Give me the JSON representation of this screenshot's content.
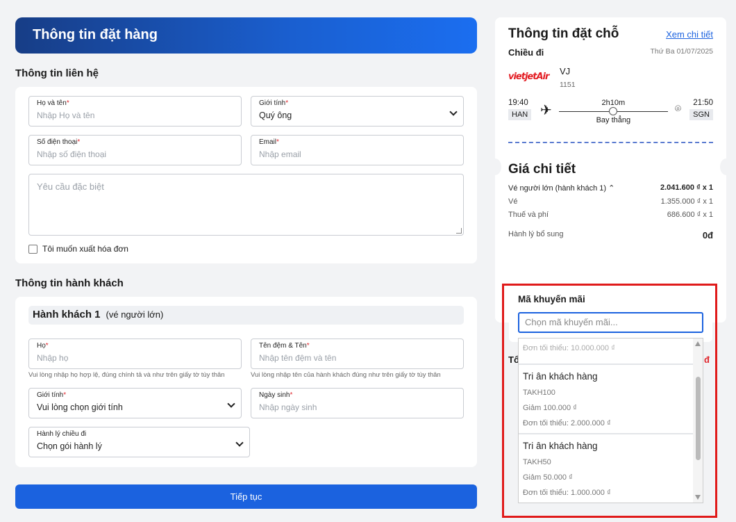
{
  "order": {
    "hero_title": "Thông tin đặt hàng",
    "contact_title": "Thông tin liên hệ",
    "fullname_label": "Họ và tên",
    "fullname_placeholder": "Nhập Họ và tên",
    "gender_label": "Giới tính",
    "gender_value": "Quý ông",
    "phone_label": "Số điện thoại",
    "phone_placeholder": "Nhập số điện thoại",
    "email_label": "Email",
    "email_placeholder": "Nhập email",
    "special_placeholder": "Yêu cầu đặc biệt",
    "invoice_label": "Tôi muốn xuất hóa đơn",
    "passenger_title": "Thông tin hành khách",
    "pax_heading": "Hành khách 1",
    "pax_type": "(vé người lớn)",
    "last_label": "Họ",
    "last_placeholder": "Nhập họ",
    "last_hint": "Vui lòng nhập họ hợp lệ, đúng chính tả và như trên giấy tờ tùy thân",
    "given_label": "Tên đệm & Tên",
    "given_placeholder": "Nhập tên đệm và tên",
    "given_hint": "Vui lòng nhập tên của hành khách đúng như trên giấy tờ tùy thân",
    "pax_gender_label": "Giới tính",
    "pax_gender_value": "Vui lòng chọn giới tính",
    "dob_label": "Ngày sinh",
    "dob_placeholder": "Nhập ngày sinh",
    "luggage_label": "Hành lý chiều đi",
    "luggage_value": "Chọn gói hành lý",
    "continue_label": "Tiếp tục"
  },
  "booking": {
    "title": "Thông tin đặt chỗ",
    "details_link": "Xem chi tiết",
    "direction": "Chiều đi",
    "date": "Thứ Ba 01/07/2025",
    "airline_logo": "vietjetAir",
    "airline_code": "VJ",
    "flight_no": "1151",
    "dep_time": "19:40",
    "dep_airport": "HAN",
    "duration": "2h10m",
    "flight_type": "Bay thẳng",
    "arr_time": "21:50",
    "arr_airport": "SGN",
    "price_title": "Giá chi tiết",
    "adult_label": "Vé người lớn (hành khách 1)",
    "adult_amount": "2.041.600 ₫ x 1",
    "ticket_label": "Vé",
    "ticket_amount": "1.355.000 ₫ x 1",
    "tax_label": "Thuế và phí",
    "tax_amount": "686.600 ₫ x 1",
    "extra_label": "Hành lý bổ sung",
    "extra_amount": "0đ",
    "total_peek": "Tổ",
    "total_peek_amount": "đ"
  },
  "promo": {
    "title": "Mã khuyến mãi",
    "placeholder": "Chọn mã khuyến mãi...",
    "partial_min": "Đơn tối thiểu: 10.000.000 ₫",
    "items": [
      {
        "name": "Tri ân khách hàng",
        "code": "TAKH100",
        "discount": "Giảm 100.000 ₫",
        "min": "Đơn tối thiểu: 2.000.000 ₫"
      },
      {
        "name": "Tri ân khách hàng",
        "code": "TAKH50",
        "discount": "Giảm 50.000 ₫",
        "min": "Đơn tối thiểu: 1.000.000 ₫"
      }
    ]
  },
  "colors": {
    "primary": "#1b62df",
    "highlight": "#e01a1a",
    "airline": "#e31e24"
  }
}
